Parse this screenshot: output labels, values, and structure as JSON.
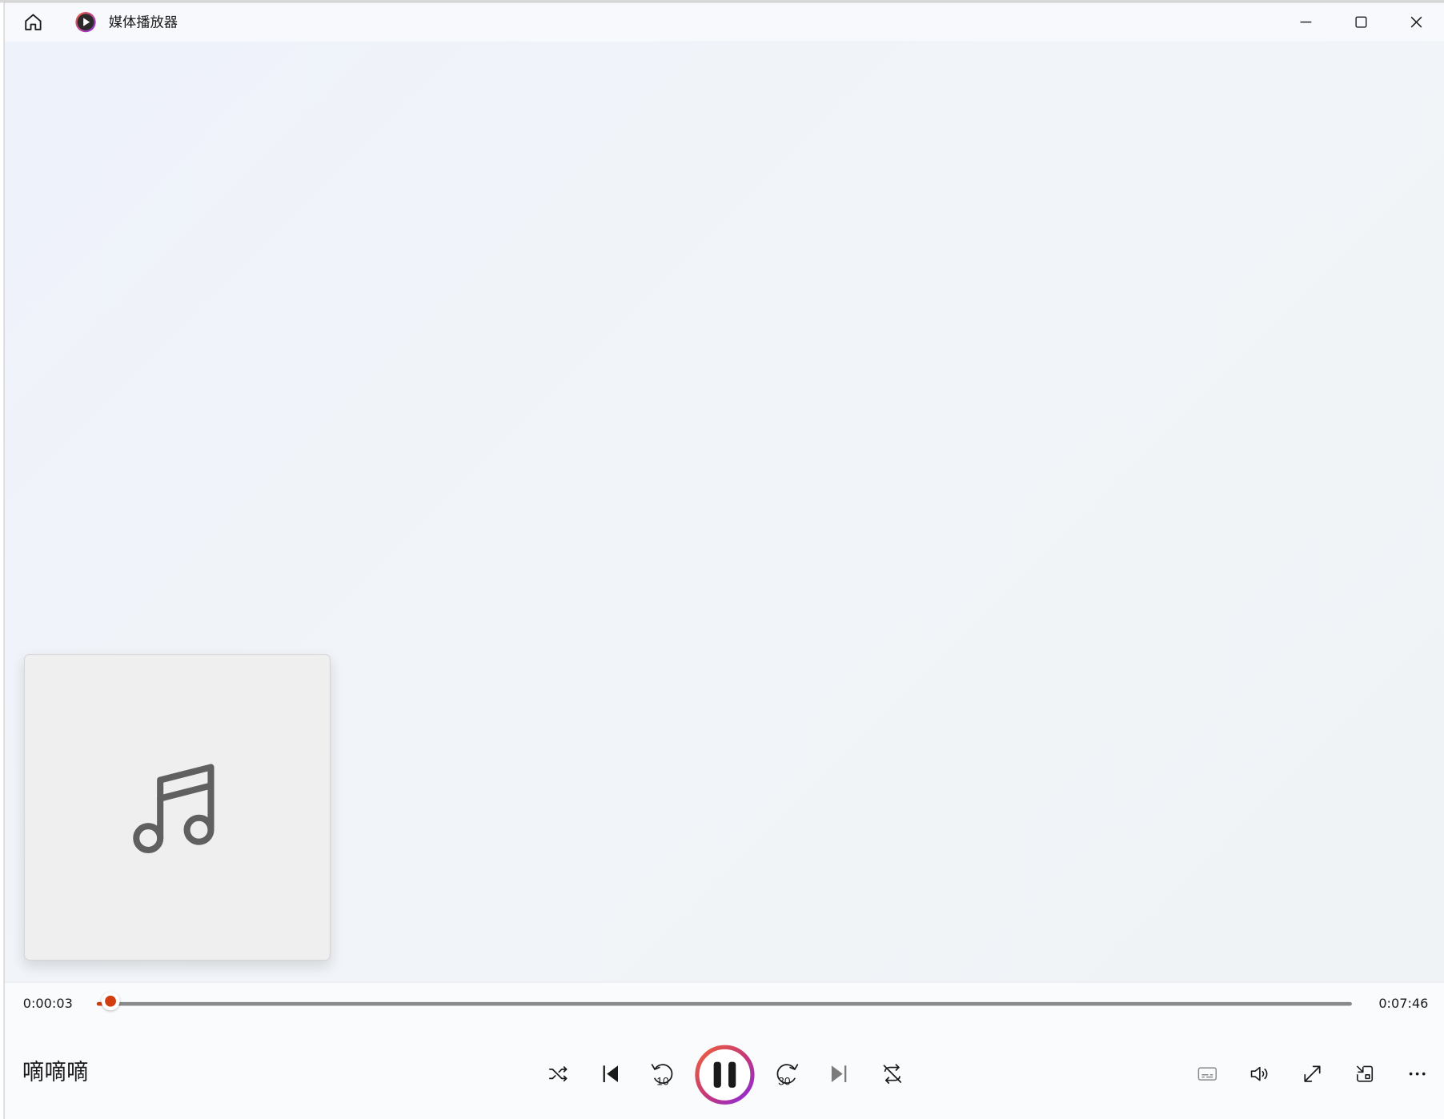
{
  "app": {
    "title": "媒体播放器"
  },
  "track": {
    "name": "嘀嘀嘀"
  },
  "time": {
    "elapsed": "0:00:03",
    "total": "0:07:46",
    "progress": 0.0107
  },
  "colors": {
    "accent": "#d13d0e",
    "ring_start": "#f0623a",
    "ring_end": "#8a2be2",
    "track": "#8a8a8a"
  },
  "icons": {
    "home": "home-icon",
    "app": "media-player-logo",
    "minimize": "minimize-icon",
    "maximize": "maximize-icon",
    "close": "close-icon",
    "shuffle": "shuffle-icon",
    "previous": "previous-icon",
    "rewind": "rewind-10-icon",
    "pause": "pause-icon",
    "forward": "forward-30-icon",
    "next": "next-icon",
    "repeat": "repeat-icon",
    "captions": "captions-icon",
    "volume": "volume-icon",
    "fullscreen": "fullscreen-icon",
    "miniplayer": "miniplayer-icon",
    "more": "more-icon",
    "album_art": "music-note-icon"
  }
}
